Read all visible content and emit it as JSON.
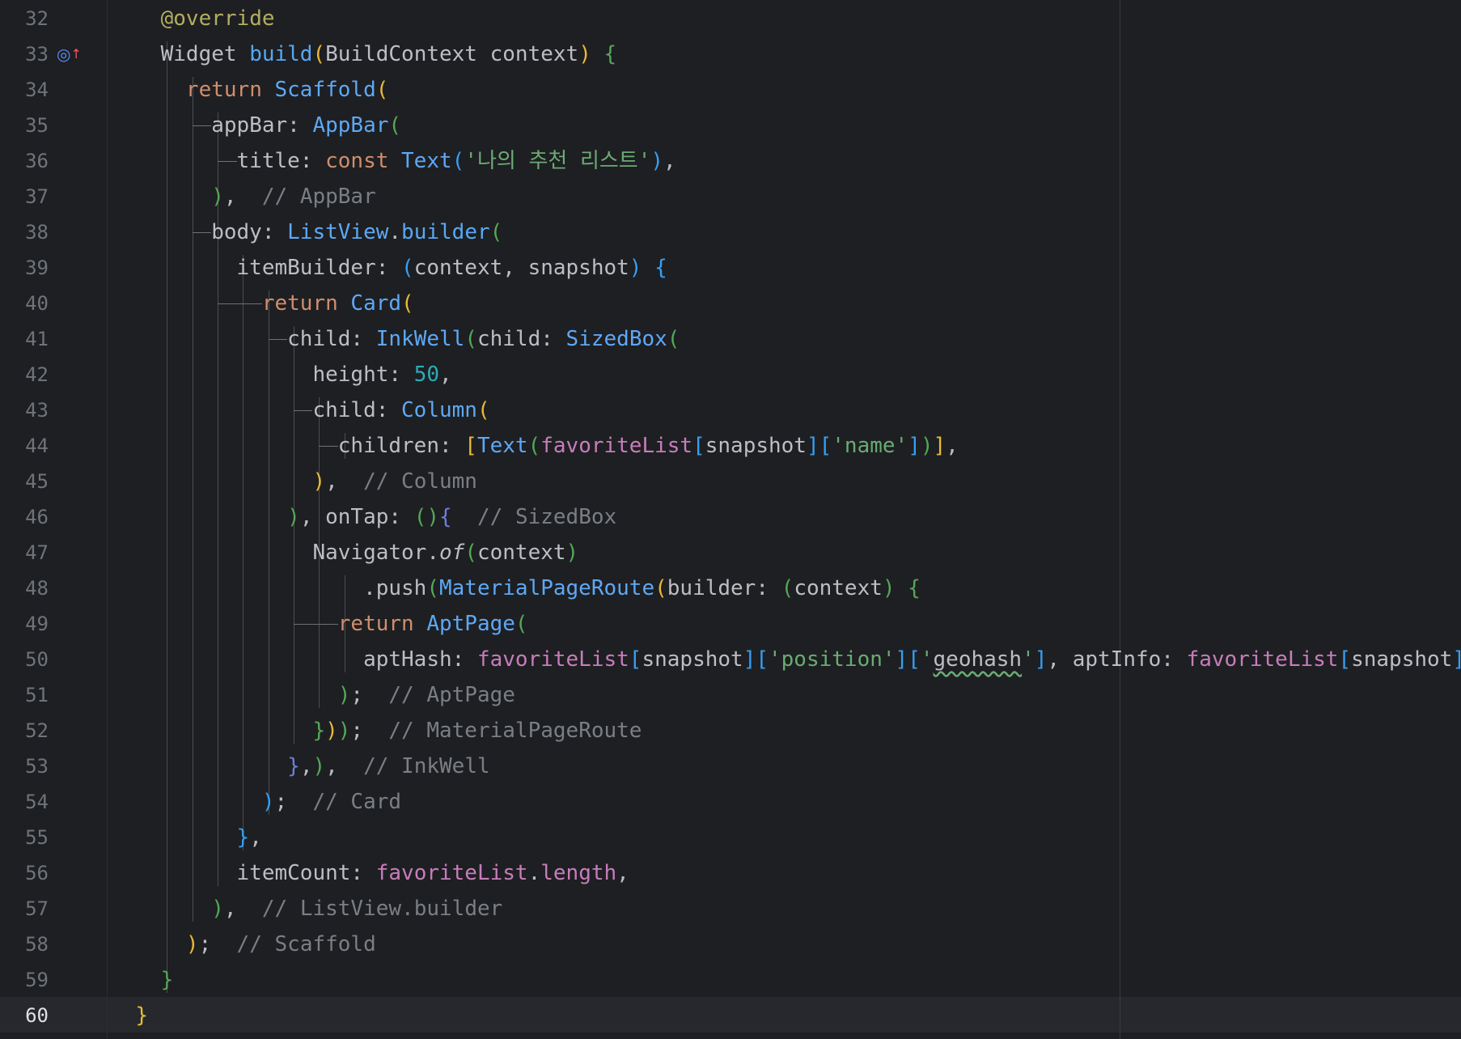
{
  "editor": {
    "language": "dart",
    "active_line": 60,
    "lines": [
      {
        "n": "32",
        "tokens": [
          [
            "    ",
            ""
          ],
          [
            "@override",
            "ann"
          ]
        ]
      },
      {
        "n": "33",
        "marker": true,
        "tokens": [
          [
            "    Widget ",
            ""
          ],
          [
            "build",
            "fn"
          ],
          [
            "(",
            "brace1"
          ],
          [
            "BuildContext context",
            ""
          ],
          [
            ")",
            "brace1"
          ],
          [
            " ",
            ""
          ],
          [
            "{",
            "brace2"
          ]
        ]
      },
      {
        "n": "34",
        "tokens": [
          [
            "      ",
            ""
          ],
          [
            "return ",
            "kw"
          ],
          [
            "Scaffold",
            "cls"
          ],
          [
            "(",
            "brace1"
          ]
        ]
      },
      {
        "n": "35",
        "tokens": [
          [
            "        appBar: ",
            ""
          ],
          [
            "AppBar",
            "cls"
          ],
          [
            "(",
            "brace2"
          ]
        ]
      },
      {
        "n": "36",
        "tokens": [
          [
            "          title: ",
            ""
          ],
          [
            "const ",
            "kw"
          ],
          [
            "Text",
            "cls"
          ],
          [
            "(",
            "brace3"
          ],
          [
            "'나의 추천 리스트'",
            "str"
          ],
          [
            ")",
            "brace3"
          ],
          [
            ",",
            ""
          ]
        ]
      },
      {
        "n": "37",
        "tokens": [
          [
            "        ",
            ""
          ],
          [
            ")",
            "brace2"
          ],
          [
            ",  ",
            ""
          ],
          [
            "// AppBar",
            "cmt"
          ]
        ]
      },
      {
        "n": "38",
        "tokens": [
          [
            "        body: ",
            ""
          ],
          [
            "ListView",
            "cls"
          ],
          [
            ".",
            ""
          ],
          [
            "builder",
            "fn"
          ],
          [
            "(",
            "brace2"
          ]
        ]
      },
      {
        "n": "39",
        "tokens": [
          [
            "          itemBuilder: ",
            ""
          ],
          [
            "(",
            "brace3"
          ],
          [
            "context, snapshot",
            ""
          ],
          [
            ")",
            "brace3"
          ],
          [
            " ",
            ""
          ],
          [
            "{",
            "brace3"
          ]
        ]
      },
      {
        "n": "40",
        "tokens": [
          [
            "            ",
            ""
          ],
          [
            "return ",
            "kw"
          ],
          [
            "Card",
            "cls"
          ],
          [
            "(",
            "brace1"
          ]
        ]
      },
      {
        "n": "41",
        "tokens": [
          [
            "              child: ",
            ""
          ],
          [
            "InkWell",
            "cls"
          ],
          [
            "(",
            "brace2"
          ],
          [
            "child: ",
            ""
          ],
          [
            "SizedBox",
            "cls"
          ],
          [
            "(",
            "brace2"
          ]
        ]
      },
      {
        "n": "42",
        "tokens": [
          [
            "                height: ",
            ""
          ],
          [
            "50",
            "num"
          ],
          [
            ",",
            ""
          ]
        ]
      },
      {
        "n": "43",
        "tokens": [
          [
            "                child: ",
            ""
          ],
          [
            "Column",
            "cls"
          ],
          [
            "(",
            "brace1"
          ]
        ]
      },
      {
        "n": "44",
        "tokens": [
          [
            "                  children: ",
            ""
          ],
          [
            "[",
            "brace1"
          ],
          [
            "Text",
            "cls"
          ],
          [
            "(",
            "brace2"
          ],
          [
            "favoriteList",
            "field"
          ],
          [
            "[",
            "brace3"
          ],
          [
            "snapshot",
            ""
          ],
          [
            "]",
            "brace3"
          ],
          [
            "[",
            "brace3"
          ],
          [
            "'name'",
            "str"
          ],
          [
            "]",
            "brace3"
          ],
          [
            ")",
            "brace2"
          ],
          [
            "]",
            "brace1"
          ],
          [
            ",",
            ""
          ]
        ]
      },
      {
        "n": "45",
        "tokens": [
          [
            "                ",
            ""
          ],
          [
            ")",
            "brace1"
          ],
          [
            ",  ",
            ""
          ],
          [
            "// Column",
            "cmt"
          ]
        ]
      },
      {
        "n": "46",
        "tokens": [
          [
            "              ",
            ""
          ],
          [
            ")",
            "brace2"
          ],
          [
            ", onTap: ",
            ""
          ],
          [
            "()",
            "brace2"
          ],
          [
            "{",
            "brace4"
          ],
          [
            "  ",
            ""
          ],
          [
            "// SizedBox",
            "cmt"
          ]
        ]
      },
      {
        "n": "47",
        "tokens": [
          [
            "                Navigator.",
            ""
          ],
          [
            "of",
            "italic"
          ],
          [
            "(",
            "brace2"
          ],
          [
            "context",
            ""
          ],
          [
            ")",
            "brace2"
          ]
        ]
      },
      {
        "n": "48",
        "tokens": [
          [
            "                    .push",
            ""
          ],
          [
            "(",
            "brace2"
          ],
          [
            "MaterialPageRoute",
            "cls"
          ],
          [
            "(",
            "brace1"
          ],
          [
            "builder: ",
            ""
          ],
          [
            "(",
            "brace2"
          ],
          [
            "context",
            ""
          ],
          [
            ")",
            "brace2"
          ],
          [
            " ",
            ""
          ],
          [
            "{",
            "brace2"
          ]
        ]
      },
      {
        "n": "49",
        "tokens": [
          [
            "                  ",
            ""
          ],
          [
            "return ",
            "kw"
          ],
          [
            "AptPage",
            "cls"
          ],
          [
            "(",
            "brace2"
          ]
        ]
      },
      {
        "n": "50",
        "tokens": [
          [
            "                    aptHash: ",
            ""
          ],
          [
            "favoriteList",
            "field"
          ],
          [
            "[",
            "brace3"
          ],
          [
            "snapshot",
            ""
          ],
          [
            "]",
            "brace3"
          ],
          [
            "[",
            "brace3"
          ],
          [
            "'position'",
            "str"
          ],
          [
            "]",
            "brace3"
          ],
          [
            "[",
            "brace3"
          ],
          [
            "'",
            "str"
          ],
          [
            "geohash",
            "typo"
          ],
          [
            "'",
            "str"
          ],
          [
            "]",
            "brace3"
          ],
          [
            ", aptInfo: ",
            ""
          ],
          [
            "favoriteList",
            "field"
          ],
          [
            "[",
            "brace3"
          ],
          [
            "snapshot",
            ""
          ],
          [
            "]",
            "brace3"
          ],
          [
            ",",
            ""
          ]
        ]
      },
      {
        "n": "51",
        "tokens": [
          [
            "                  ",
            ""
          ],
          [
            ")",
            "brace2"
          ],
          [
            ";  ",
            ""
          ],
          [
            "// AptPage",
            "cmt"
          ]
        ]
      },
      {
        "n": "52",
        "tokens": [
          [
            "                ",
            ""
          ],
          [
            "}",
            "brace2"
          ],
          [
            ")",
            "brace1"
          ],
          [
            ")",
            "brace2"
          ],
          [
            ";  ",
            ""
          ],
          [
            "// MaterialPageRoute",
            "cmt"
          ]
        ]
      },
      {
        "n": "53",
        "tokens": [
          [
            "              ",
            ""
          ],
          [
            "}",
            "brace4"
          ],
          [
            ",",
            ""
          ],
          [
            ")",
            "brace2"
          ],
          [
            ",  ",
            ""
          ],
          [
            "// InkWell",
            "cmt"
          ]
        ]
      },
      {
        "n": "54",
        "tokens": [
          [
            "            ",
            ""
          ],
          [
            ")",
            "brace3"
          ],
          [
            ";  ",
            ""
          ],
          [
            "// Card",
            "cmt"
          ]
        ]
      },
      {
        "n": "55",
        "tokens": [
          [
            "          ",
            ""
          ],
          [
            "}",
            "brace3"
          ],
          [
            ",",
            ""
          ]
        ]
      },
      {
        "n": "56",
        "tokens": [
          [
            "          itemCount: ",
            ""
          ],
          [
            "favoriteList",
            "field"
          ],
          [
            ".",
            ""
          ],
          [
            "length",
            "field"
          ],
          [
            ",",
            ""
          ]
        ]
      },
      {
        "n": "57",
        "tokens": [
          [
            "        ",
            ""
          ],
          [
            ")",
            "brace2"
          ],
          [
            ",  ",
            ""
          ],
          [
            "// ListView.builder",
            "cmt"
          ]
        ]
      },
      {
        "n": "58",
        "tokens": [
          [
            "      ",
            ""
          ],
          [
            ")",
            "brace1"
          ],
          [
            ";  ",
            ""
          ],
          [
            "// Scaffold",
            "cmt"
          ]
        ]
      },
      {
        "n": "59",
        "tokens": [
          [
            "    ",
            ""
          ],
          [
            "}",
            "brace2"
          ]
        ]
      },
      {
        "n": "60",
        "tokens": [
          [
            "  ",
            ""
          ],
          [
            "}",
            "brace1"
          ]
        ]
      }
    ]
  },
  "gutter_marker": {
    "icon": "override-implementation-icon",
    "glyph": "◎",
    "arrow": "↑"
  },
  "colors": {
    "background": "#1e1f22",
    "keyword": "#cf8e6d",
    "class": "#56a8f5",
    "string": "#6aab73",
    "number": "#2aacb8",
    "comment": "#7a7e85",
    "field": "#c77dbb",
    "annotation": "#b3ae60"
  }
}
